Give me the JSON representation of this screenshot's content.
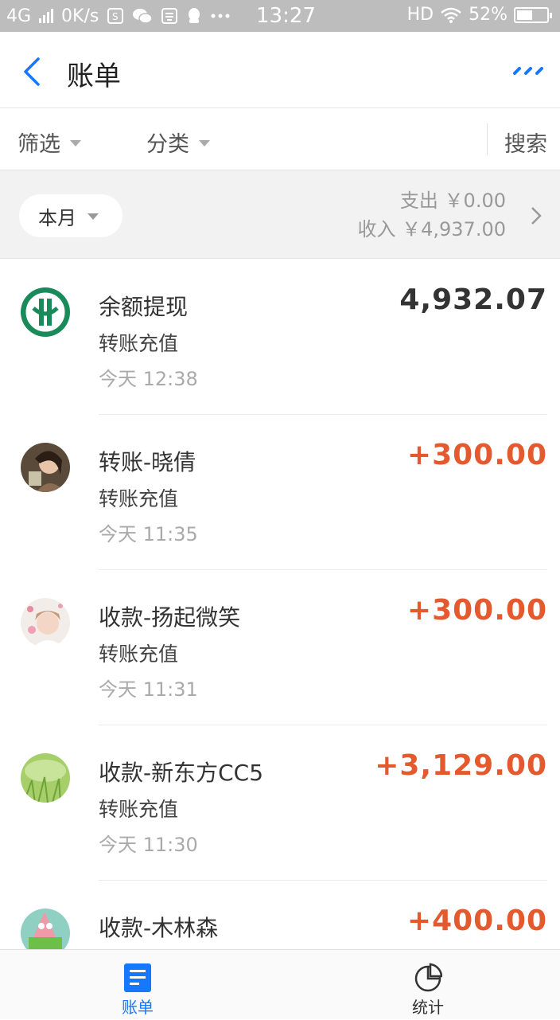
{
  "status_bar": {
    "network": "4G",
    "speed": "0K/s",
    "time": "13:27",
    "hd": "HD",
    "battery_text": "52%",
    "battery_level": 0.52
  },
  "header": {
    "title": "账单"
  },
  "filters": {
    "filter_label": "筛选",
    "category_label": "分类",
    "search_label": "搜索"
  },
  "summary": {
    "period": "本月",
    "expense_line": "支出 ￥0.00",
    "income_line": "收入 ￥4,937.00"
  },
  "transactions": [
    {
      "title": "余额提现",
      "subtitle": "转账充值",
      "time": "今天  12:38",
      "amount": "4,932.07",
      "avatar": "abc-bank-logo",
      "accent": "#1a8a5a"
    },
    {
      "title": "转账-晓倩",
      "subtitle": "转账充值",
      "time": "今天  11:35",
      "amount": "+300.00",
      "avatar": "user-photo-avatar"
    },
    {
      "title": "收款-扬起微笑",
      "subtitle": "转账充值",
      "time": "今天  11:31",
      "amount": "+300.00",
      "avatar": "user-photo-avatar"
    },
    {
      "title": "收款-新东方CC5",
      "subtitle": "转账充值",
      "time": "今天  11:30",
      "amount": "+3,129.00",
      "avatar": "grass-photo-avatar"
    },
    {
      "title": "收款-木林森",
      "subtitle": "",
      "time": "",
      "amount": "+400.00",
      "avatar": "cartoon-avatar"
    }
  ],
  "colors": {
    "accent_blue": "#1677ff",
    "income_red": "#e45a2e"
  },
  "tabbar": {
    "tabs": [
      {
        "label": "账单",
        "icon": "bill-list-icon",
        "active": true
      },
      {
        "label": "统计",
        "icon": "pie-chart-icon",
        "active": false
      }
    ]
  }
}
